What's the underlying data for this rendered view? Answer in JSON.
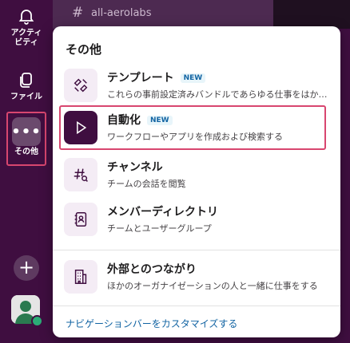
{
  "rail": {
    "activity_label": "アクティビティ",
    "activity_line1": "アクティ",
    "activity_line2": "ビティ",
    "files_label": "ファイル",
    "more_label": "その他",
    "more_glyph": "•••",
    "add_glyph": "+"
  },
  "channel": {
    "hash": "#",
    "name": "all-aerolabs"
  },
  "menu": {
    "title": "その他",
    "items": [
      {
        "title": "テンプレート",
        "badge": "NEW",
        "desc": "これらの事前設定済みバンドルであらゆる仕事をはかどらせよう",
        "icon": "template-icon"
      },
      {
        "title": "自動化",
        "badge": "NEW",
        "desc": "ワークフローやアプリを作成および検索する",
        "icon": "play-icon"
      },
      {
        "title": "チャンネル",
        "desc": "チームの会話を閲覧",
        "icon": "channel-icon"
      },
      {
        "title": "メンバーディレクトリ",
        "desc": "チームとユーザーグループ",
        "icon": "directory-icon"
      },
      {
        "title": "外部とのつながり",
        "desc": "ほかのオーガナイゼーションの人と一緒に仕事をする",
        "icon": "building-icon"
      }
    ],
    "footer_link": "ナビゲーションバーをカスタマイズする"
  },
  "colors": {
    "sidebar": "#3f0e40",
    "accent": "#d8466f",
    "link": "#1264a3"
  }
}
